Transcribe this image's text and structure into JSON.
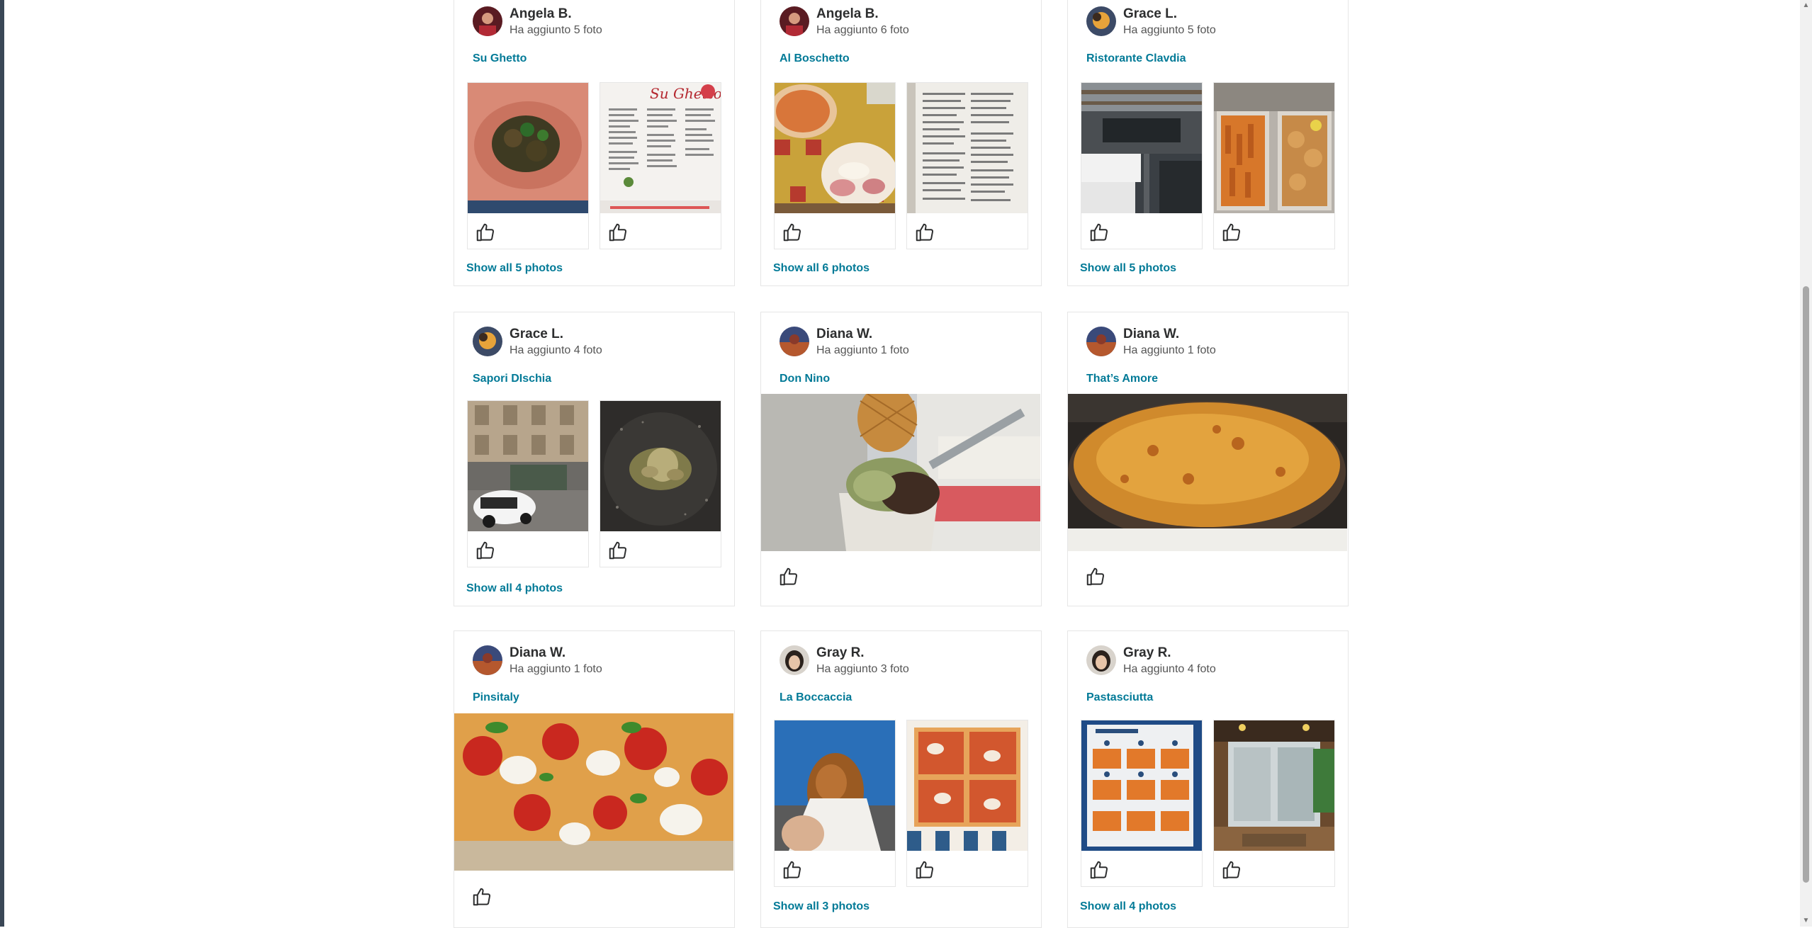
{
  "cards": [
    {
      "user": "Angela B.",
      "sub": "Ha aggiunto 5 foto",
      "business": "Su Ghetto",
      "show_all": "Show all 5 photos"
    },
    {
      "user": "Angela B.",
      "sub": "Ha aggiunto 6 foto",
      "business": "Al Boschetto",
      "show_all": "Show all 6 photos"
    },
    {
      "user": "Grace L.",
      "sub": "Ha aggiunto 5 foto",
      "business": "Ristorante Clavdia",
      "show_all": "Show all 5 photos"
    },
    {
      "user": "Grace L.",
      "sub": "Ha aggiunto 4 foto",
      "business": "Sapori DIschia",
      "show_all": "Show all 4 photos"
    },
    {
      "user": "Diana W.",
      "sub": "Ha aggiunto 1 foto",
      "business": "Don Nino"
    },
    {
      "user": "Diana W.",
      "sub": "Ha aggiunto 1 foto",
      "business": "That’s Amore"
    },
    {
      "user": "Diana W.",
      "sub": "Ha aggiunto 1 foto",
      "business": "Pinsitaly"
    },
    {
      "user": "Gray R.",
      "sub": "Ha aggiunto 3 foto",
      "business": "La Boccaccia",
      "show_all": "Show all 3 photos"
    },
    {
      "user": "Gray R.",
      "sub": "Ha aggiunto 4 foto",
      "business": "Pastasciutta",
      "show_all": "Show all 4 photos"
    }
  ],
  "icons": {
    "like": "thumbs-up-icon"
  },
  "colors": {
    "link": "#027a97",
    "border": "#e6e6e6",
    "text": "#2d2e2f"
  }
}
